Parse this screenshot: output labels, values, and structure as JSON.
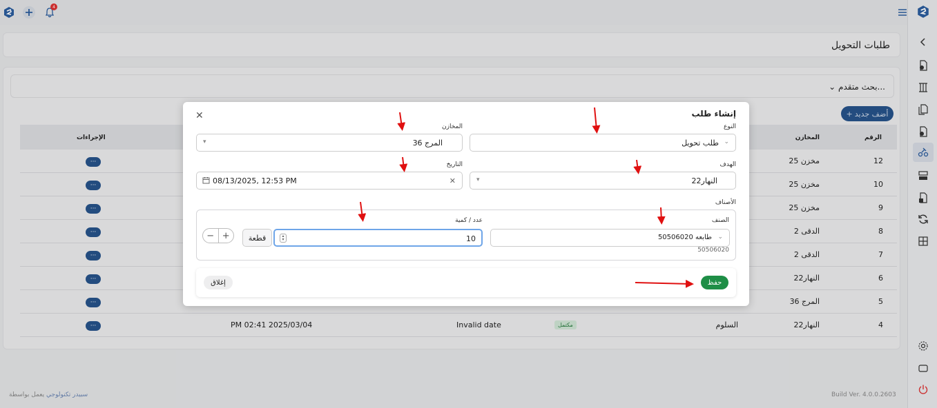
{
  "header": {
    "notification_count": "4"
  },
  "page": {
    "title": "طلبات التحويل"
  },
  "search": {
    "advanced_label": "بحث متقدم..."
  },
  "toolbar": {
    "add_label": "أضف جديد"
  },
  "table": {
    "headers": {
      "number": "الرقم",
      "warehouse": "المخازن",
      "actions": "الإجراءات"
    },
    "rows": [
      {
        "number": "12",
        "warehouse": "مخزن 25"
      },
      {
        "number": "10",
        "warehouse": "مخزن 25"
      },
      {
        "number": "9",
        "warehouse": "مخزن 25"
      },
      {
        "number": "8",
        "warehouse": "الدقى 2"
      },
      {
        "number": "7",
        "warehouse": "الدقى 2"
      },
      {
        "number": "6",
        "warehouse": "النهار22"
      },
      {
        "number": "5",
        "warehouse": "المرج 36"
      },
      {
        "number": "4",
        "warehouse": "النهار22",
        "target": "السلوم",
        "status": "مكتمل",
        "date": "Invalid date",
        "created": "PM 02:41 2025/03/04"
      }
    ],
    "actions_label": "···"
  },
  "modal": {
    "title": "إنشاء طلب",
    "type_label": "النوع",
    "type_value": "طلب تحويل",
    "warehouse_label": "المخازن",
    "warehouse_value": "المرج 36",
    "target_label": "الهدف",
    "target_value": "النهار22",
    "date_label": "التاريخ",
    "date_value": "08/13/2025, 12:53 PM",
    "items_label": "الأصناف",
    "item_label": "الصنف",
    "item_value": "طابعه 50506020",
    "item_code": "50506020",
    "qty_label": "عدد / كمية",
    "qty_value": "10",
    "unit_value": "قطعة",
    "close_label": "إغلاق",
    "save_label": "حفظ"
  },
  "footer": {
    "powered_prefix": "يعمل بواسطة",
    "powered_link": "سبيدر تكنولوجي",
    "build": "Build Ver. 4.0.0.2603"
  },
  "colors": {
    "primary": "#27538a",
    "save": "#1e8e46",
    "arrow": "#e01010",
    "complete_bg": "#cfe4d4"
  }
}
